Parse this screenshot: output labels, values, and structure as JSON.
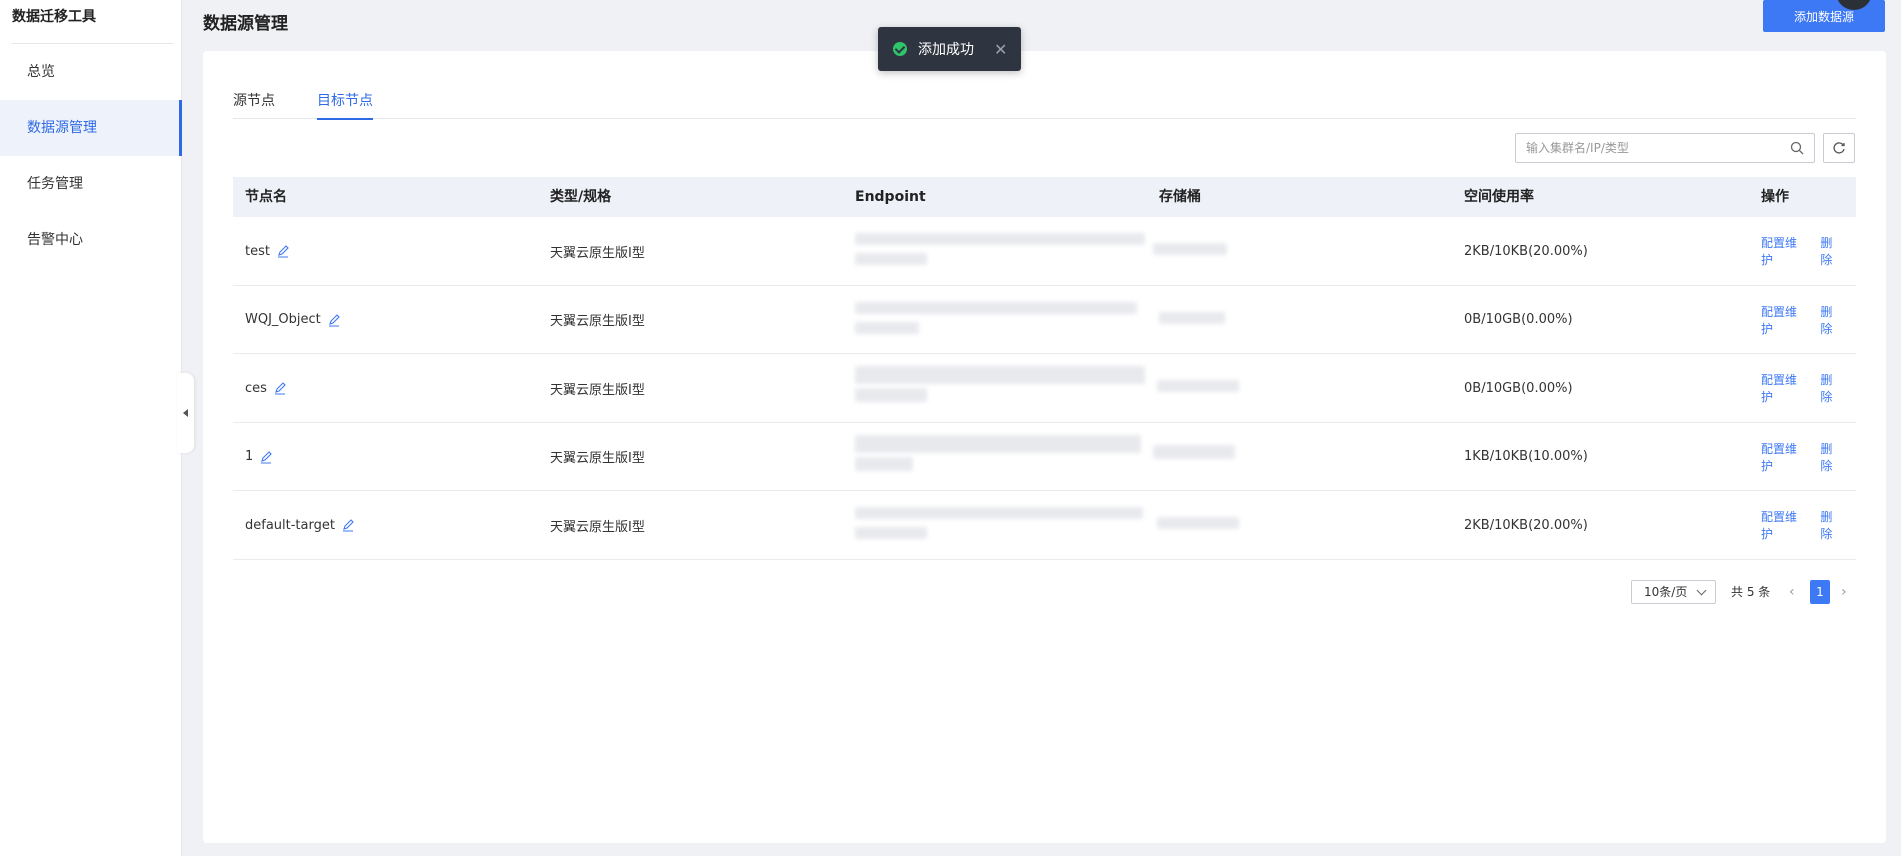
{
  "app": {
    "title": "数据迁移工具"
  },
  "sidebar": {
    "items": [
      {
        "label": "总览"
      },
      {
        "label": "数据源管理"
      },
      {
        "label": "任务管理"
      },
      {
        "label": "告警中心"
      }
    ]
  },
  "header": {
    "title": "数据源管理",
    "add_button": "添加数据源"
  },
  "toast": {
    "message": "添加成功",
    "close_icon": "close-icon",
    "status_icon": "check-circle-icon",
    "color": "#2ec56a"
  },
  "tabs": [
    {
      "label": "源节点",
      "active": false
    },
    {
      "label": "目标节点",
      "active": true
    }
  ],
  "search": {
    "placeholder": "输入集群名/IP/类型",
    "value": ""
  },
  "table": {
    "headers": [
      "节点名",
      "类型/规格",
      "Endpoint",
      "存储桶",
      "空间使用率",
      "操作"
    ],
    "rows": [
      {
        "name": "test",
        "type": "天翼云原生版I型",
        "usage": "2KB/10KB(20.00%)",
        "action1": "配置维护",
        "action2": "删除"
      },
      {
        "name": "WQJ_Object",
        "type": "天翼云原生版I型",
        "usage": "0B/10GB(0.00%)",
        "action1": "配置维护",
        "action2": "删除"
      },
      {
        "name": "ces",
        "type": "天翼云原生版I型",
        "usage": "0B/10GB(0.00%)",
        "action1": "配置维护",
        "action2": "删除"
      },
      {
        "name": "1",
        "type": "天翼云原生版I型",
        "usage": "1KB/10KB(10.00%)",
        "action1": "配置维护",
        "action2": "删除"
      },
      {
        "name": "default-target",
        "type": "天翼云原生版I型",
        "usage": "2KB/10KB(20.00%)",
        "action1": "配置维护",
        "action2": "删除"
      }
    ]
  },
  "pagination": {
    "page_size": "10条/页",
    "total": "共 5 条",
    "current": "1"
  },
  "colors": {
    "accent": "#3d78f5",
    "sidebar_active_bg": "#eef2fb",
    "toast_bg": "#2f3540"
  }
}
